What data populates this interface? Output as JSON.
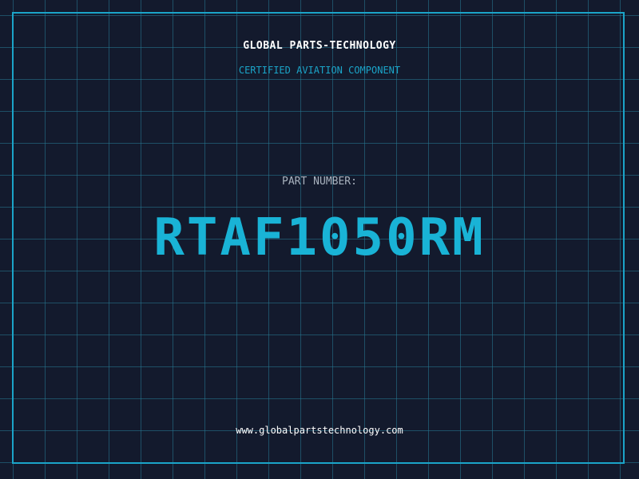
{
  "header": {
    "company": "GLOBAL PARTS-TECHNOLOGY",
    "subtitle": "CERTIFIED AVIATION COMPONENT"
  },
  "part": {
    "label": "PART NUMBER:",
    "number": "RTAF1050RM"
  },
  "footer": {
    "website": "www.globalpartstechnology.com"
  },
  "colors": {
    "background": "#131a2d",
    "grid": "#267a96",
    "accent": "#1ba4c8",
    "part_number": "#19b3d6",
    "label": "#a9b3bf",
    "text": "#ffffff"
  }
}
